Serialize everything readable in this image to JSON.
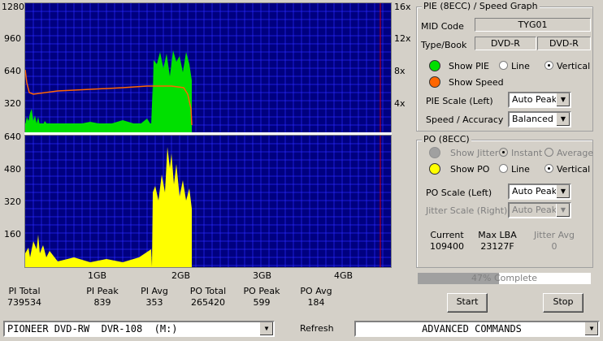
{
  "pie_graph": {
    "y_labels": [
      "1280",
      "960",
      "640",
      "320"
    ],
    "speed_labels": [
      "16x",
      "12x",
      "8x",
      "4x"
    ]
  },
  "po_graph": {
    "y_labels": [
      "640",
      "480",
      "320",
      "160"
    ]
  },
  "x_labels": [
    "1GB",
    "2GB",
    "3GB",
    "4GB"
  ],
  "stats": {
    "pi_total_label": "PI Total",
    "pi_total": "739534",
    "pi_peak_label": "PI Peak",
    "pi_peak": "839",
    "pi_avg_label": "PI Avg",
    "pi_avg": "353",
    "po_total_label": "PO Total",
    "po_total": "265420",
    "po_peak_label": "PO Peak",
    "po_peak": "599",
    "po_avg_label": "PO Avg",
    "po_avg": "184"
  },
  "pie_panel": {
    "title": "PIE (8ECC) / Speed Graph",
    "mid_code_label": "MID Code",
    "mid_code": "TYG01",
    "type_book_label": "Type/Book",
    "type": "DVD-R",
    "book": "DVD-R",
    "show_pie": "Show PIE",
    "line": "Line",
    "vertical": "Vertical",
    "show_speed": "Show Speed",
    "pie_scale_label": "PIE Scale (Left)",
    "pie_scale": "Auto Peak",
    "speed_acc_label": "Speed / Accuracy",
    "speed_acc": "Balanced",
    "pie_color": "#00e000",
    "speed_color": "#ff6600"
  },
  "po_panel": {
    "title": "PO (8ECC)",
    "show_jitter": "Show Jitter",
    "instant": "Instant",
    "average": "Average",
    "show_po": "Show PO",
    "line": "Line",
    "vertical": "Vertical",
    "po_scale_label": "PO Scale (Left)",
    "po_scale": "Auto Peak",
    "jitter_scale_label": "Jitter Scale (Right)",
    "jitter_scale": "Auto Peak",
    "current_label": "Current",
    "current": "109400",
    "max_lba_label": "Max LBA",
    "max_lba": "23127F",
    "jitter_avg_label": "Jitter Avg",
    "jitter_avg": "0",
    "po_color": "#ffff00"
  },
  "progress": {
    "text": "47% Complete",
    "value": 0.47
  },
  "buttons": {
    "start": "Start",
    "stop": "Stop",
    "refresh": "Refresh"
  },
  "drive": "PIONEER DVD-RW  DVR-108  (M:)",
  "advanced": "ADVANCED COMMANDS"
}
